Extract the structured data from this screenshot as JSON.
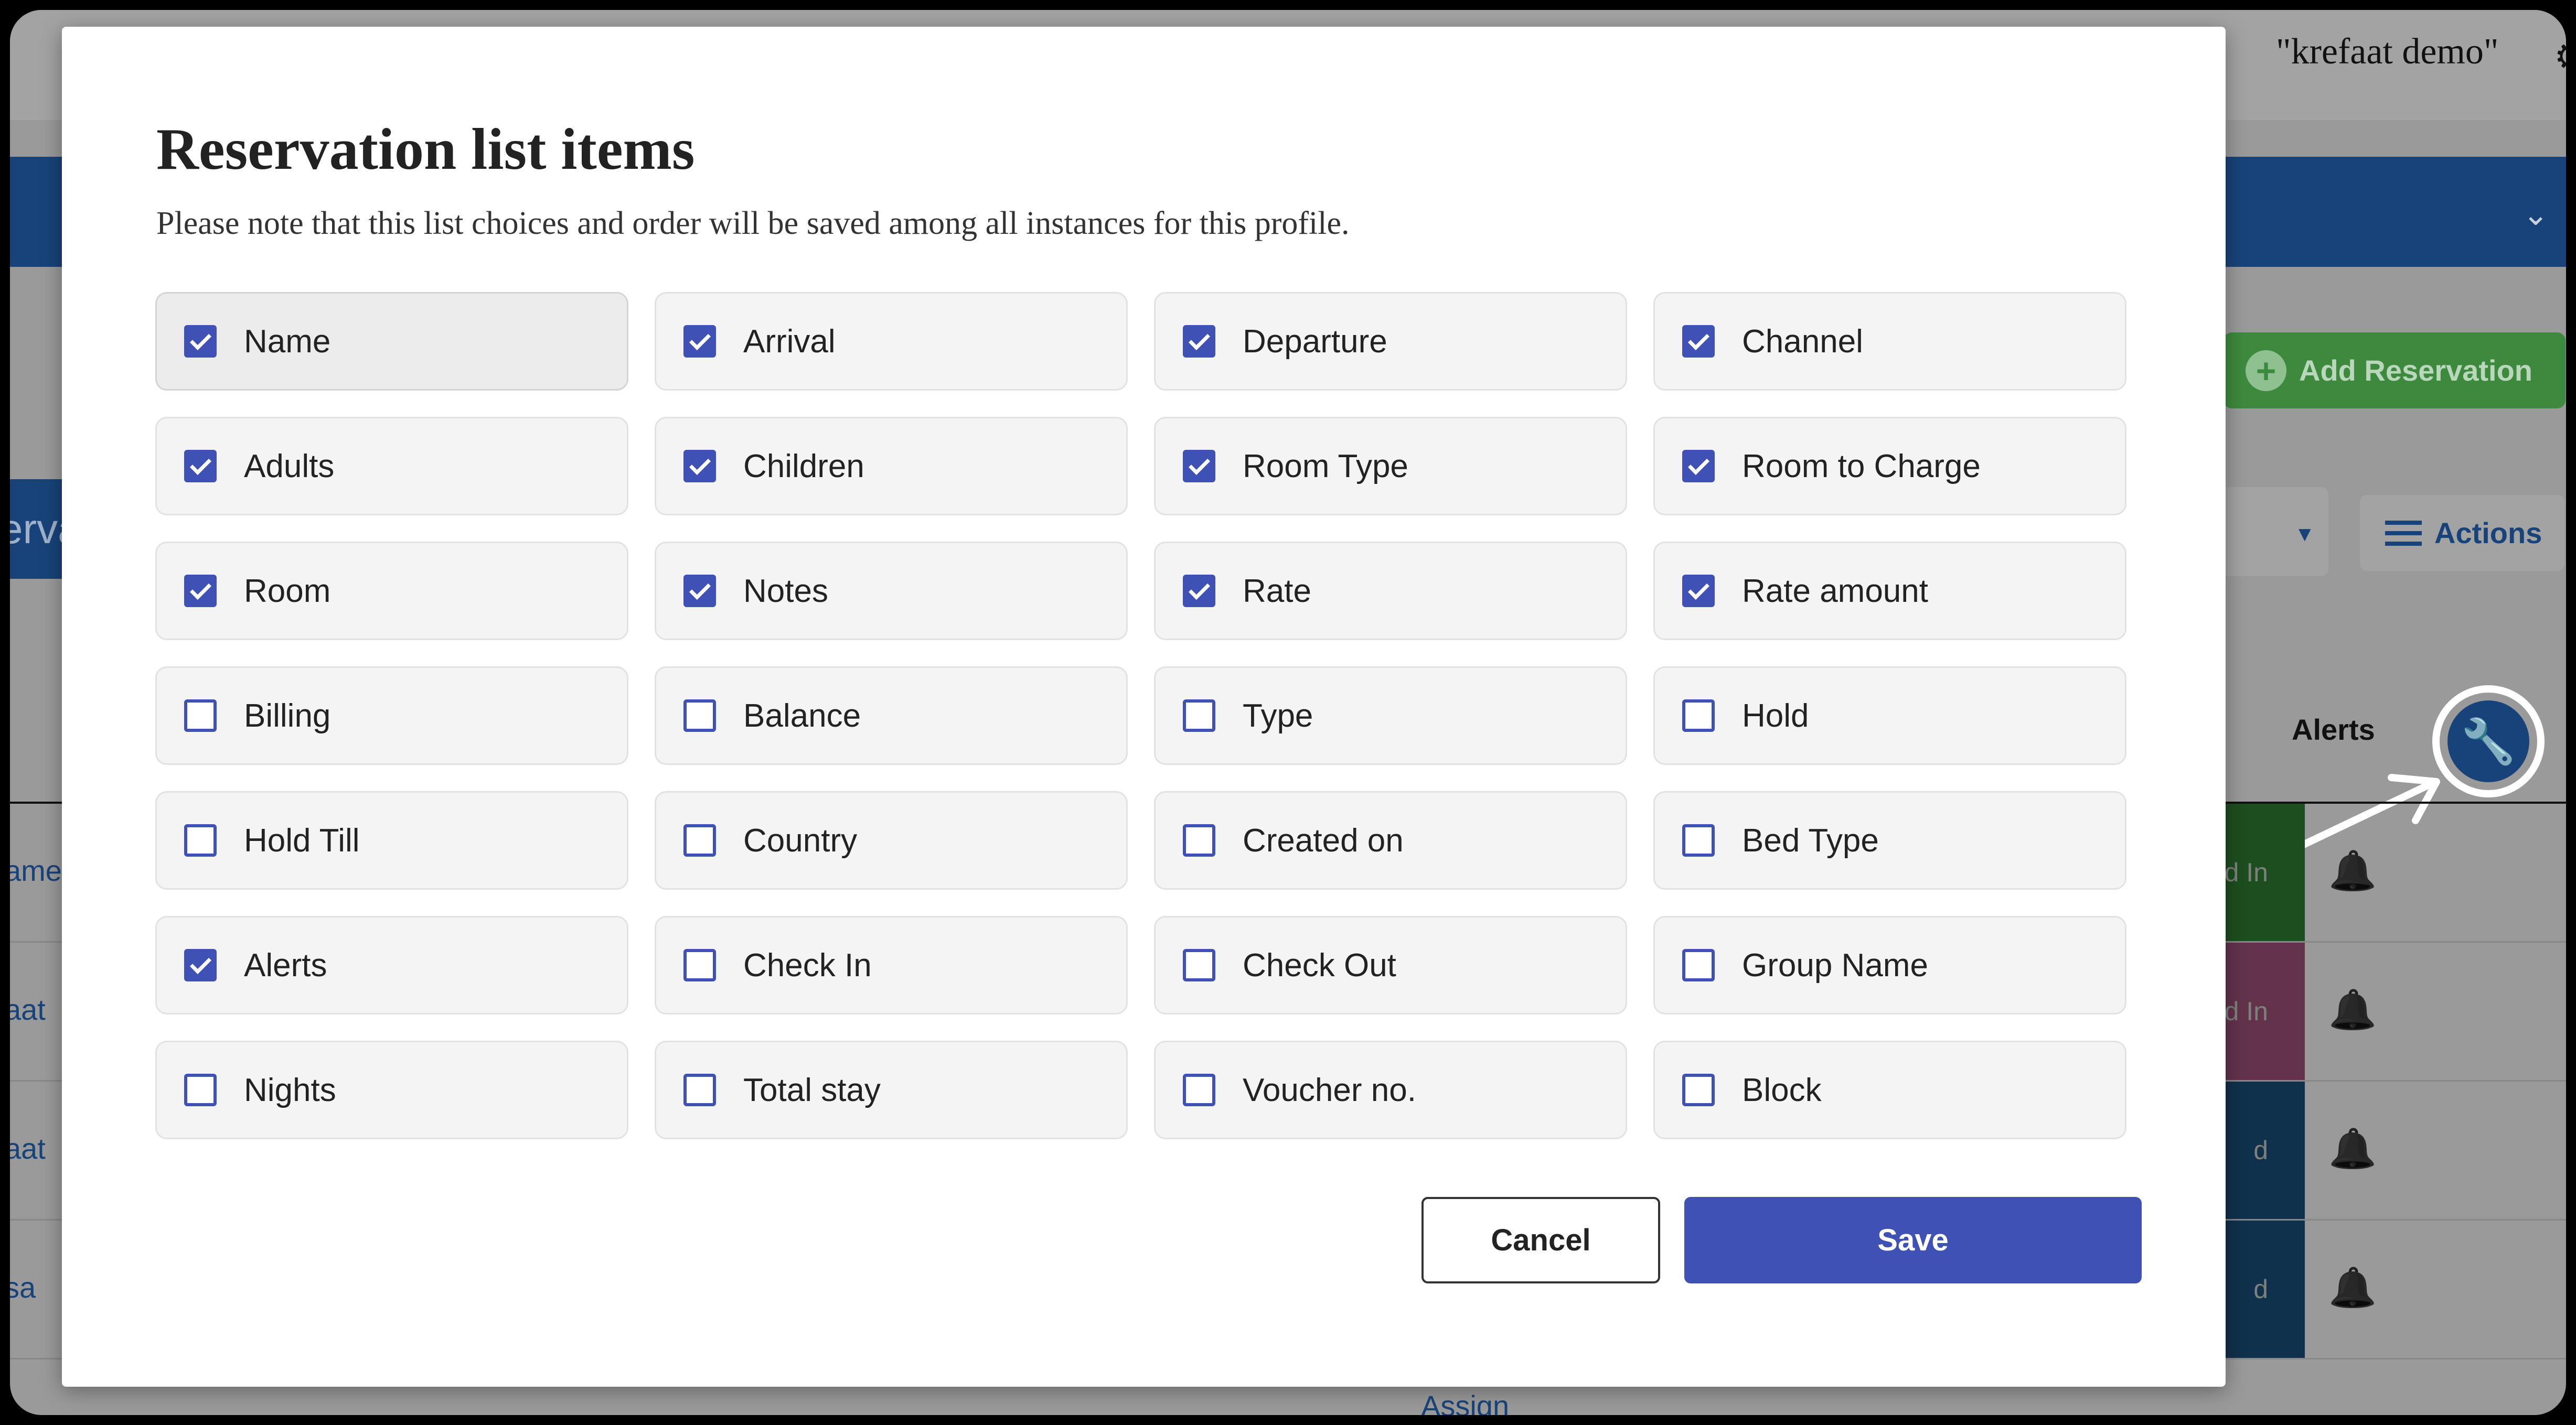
{
  "background": {
    "user_name": "\"krefaat demo\"",
    "add_reservation_label": "Add Reservation",
    "section_title": "erva",
    "actions_label": "Actions",
    "alerts_header": "Alerts",
    "rows": [
      {
        "name": "ame",
        "status": "d In",
        "status_color": "#2e7d32"
      },
      {
        "name": "aat",
        "status": "d In",
        "status_color": "#a0527a"
      },
      {
        "name": "aat",
        "status": "d",
        "status_color": "#1a4f7a"
      },
      {
        "name": "sa",
        "status": "d",
        "status_color": "#1a4f7a"
      }
    ],
    "assign_label": "Assign"
  },
  "modal": {
    "title": "Reservation list items",
    "subtitle": "Please note that this list choices and order will be saved among all instances for this profile.",
    "items": [
      {
        "label": "Name",
        "checked": true
      },
      {
        "label": "Arrival",
        "checked": true
      },
      {
        "label": "Departure",
        "checked": true
      },
      {
        "label": "Channel",
        "checked": true
      },
      {
        "label": "Adults",
        "checked": true
      },
      {
        "label": "Children",
        "checked": true
      },
      {
        "label": "Room Type",
        "checked": true
      },
      {
        "label": "Room to Charge",
        "checked": true
      },
      {
        "label": "Room",
        "checked": true
      },
      {
        "label": "Notes",
        "checked": true
      },
      {
        "label": "Rate",
        "checked": true
      },
      {
        "label": "Rate amount",
        "checked": true
      },
      {
        "label": "Billing",
        "checked": false
      },
      {
        "label": "Balance",
        "checked": false
      },
      {
        "label": "Type",
        "checked": false
      },
      {
        "label": "Hold",
        "checked": false
      },
      {
        "label": "Hold Till",
        "checked": false
      },
      {
        "label": "Country",
        "checked": false
      },
      {
        "label": "Created on",
        "checked": false
      },
      {
        "label": "Bed Type",
        "checked": false
      },
      {
        "label": "Alerts",
        "checked": true
      },
      {
        "label": "Check In",
        "checked": false
      },
      {
        "label": "Check Out",
        "checked": false
      },
      {
        "label": "Group Name",
        "checked": false
      },
      {
        "label": "Nights",
        "checked": false
      },
      {
        "label": "Total stay",
        "checked": false
      },
      {
        "label": "Voucher no.",
        "checked": false
      },
      {
        "label": "Block",
        "checked": false
      }
    ],
    "cancel_label": "Cancel",
    "save_label": "Save"
  },
  "colors": {
    "accent": "#3f51b5",
    "brand_blue": "#18437a",
    "add_green": "#3d8a3f"
  },
  "icons": {
    "checkbox_checked": "check-icon",
    "wrench": "wrench-icon",
    "bell": "bell-icon",
    "menu": "hamburger-icon",
    "plus": "plus-icon"
  }
}
